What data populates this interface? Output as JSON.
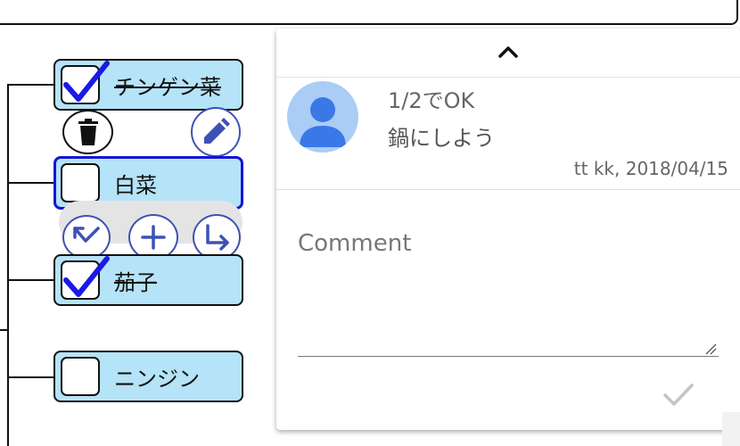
{
  "tree": {
    "nodes": [
      {
        "label": "チンゲン菜",
        "checked": true
      },
      {
        "label": "白菜",
        "checked": false,
        "selected": true
      },
      {
        "label": "茄子",
        "checked": true
      },
      {
        "label": "ニンジン",
        "checked": false
      }
    ],
    "icons": {
      "delete": "trash-icon",
      "edit": "pencil-icon",
      "outdent": "arrow-up-left-icon",
      "add": "plus-icon",
      "indent": "arrow-down-right-icon"
    }
  },
  "comment_panel": {
    "collapse_icon": "chevron-up-icon",
    "comment": {
      "line1": "1/2でOK",
      "line2": "鍋にしよう",
      "meta": "tt kk, 2018/04/15"
    },
    "input": {
      "placeholder": "Comment",
      "value": ""
    },
    "submit_icon": "check-icon"
  },
  "colors": {
    "node_bg": "#b5e3f7",
    "selected_border": "#1515d6",
    "check_blue": "#1a1ae6",
    "action_blue": "#3f51b5",
    "avatar_bg": "#a9cdf5",
    "avatar_fg": "#3b78e7"
  }
}
